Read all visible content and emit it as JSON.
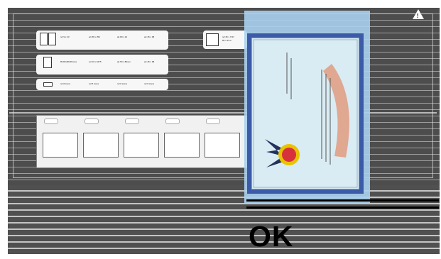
{
  "printer_panel": {
    "alert_icon": "warning-triangle-icon",
    "info_cards": [
      {
        "icon": "paper-sizes-icon",
        "col1": "ref 9 x 23",
        "col2": "art 89 x 254",
        "col3": "ab 80 x 23",
        "col4": "art 45 x 98"
      },
      {
        "icon": "envelope-icon",
        "col1": "89 89 (89.56mm)",
        "col2": "ref 23 x 6275",
        "col3": "ab 50 x 89mm",
        "col4": "art 45 x 98"
      },
      {
        "icon": "label-icon",
        "col1": "ref 8 (mm)",
        "col2": "ref 8 (mm)",
        "col3": "ref 8 (mm)",
        "col4": "ref 8 (mm)"
      }
    ],
    "side_card": {
      "icon": "tray-icon",
      "line1": "ref 45 x 7/47",
      "line2": "89 x 23 in"
    },
    "tray_steps": [
      "step-1",
      "step-2",
      "step-3",
      "step-4",
      "step-5",
      "step-6"
    ]
  },
  "preview": {
    "image": "seal-stamp-document-image"
  },
  "status_text": "OK"
}
